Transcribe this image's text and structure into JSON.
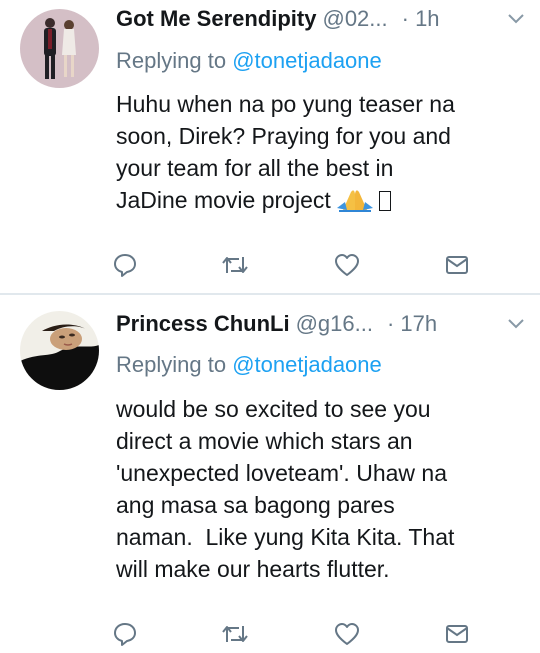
{
  "tweets": [
    {
      "name": "Got Me Serendipity",
      "handle": "@02...",
      "time": "· 1h",
      "reply_prefix": "Replying to",
      "reply_to": "@tonetjadaone",
      "lines": [
        "Huhu when na po yung teaser na",
        "soon, Direk? Praying for you and",
        "your team for all the best in",
        "JaDine movie project"
      ],
      "trailing_icons": [
        "praying-hands-emoji",
        "missing-glyph-box"
      ]
    },
    {
      "name": "Princess ChunLi",
      "handle": "@g16...",
      "time": "· 17h",
      "reply_prefix": "Replying to",
      "reply_to": "@tonetjadaone",
      "lines": [
        "would be so excited to see you",
        "direct a movie which stars an",
        "'unexpected loveteam'. Uhaw na",
        "ang masa sa bagong pares",
        "naman.  Like yung Kita Kita. That",
        "will make our hearts flutter."
      ]
    }
  ],
  "action_icons": [
    "reply-icon",
    "retweet-icon",
    "like-icon",
    "direct-message-icon"
  ],
  "colors": {
    "text": "#14171a",
    "secondary": "#657786",
    "link": "#1da1f2",
    "divider": "#e1e8ed"
  }
}
